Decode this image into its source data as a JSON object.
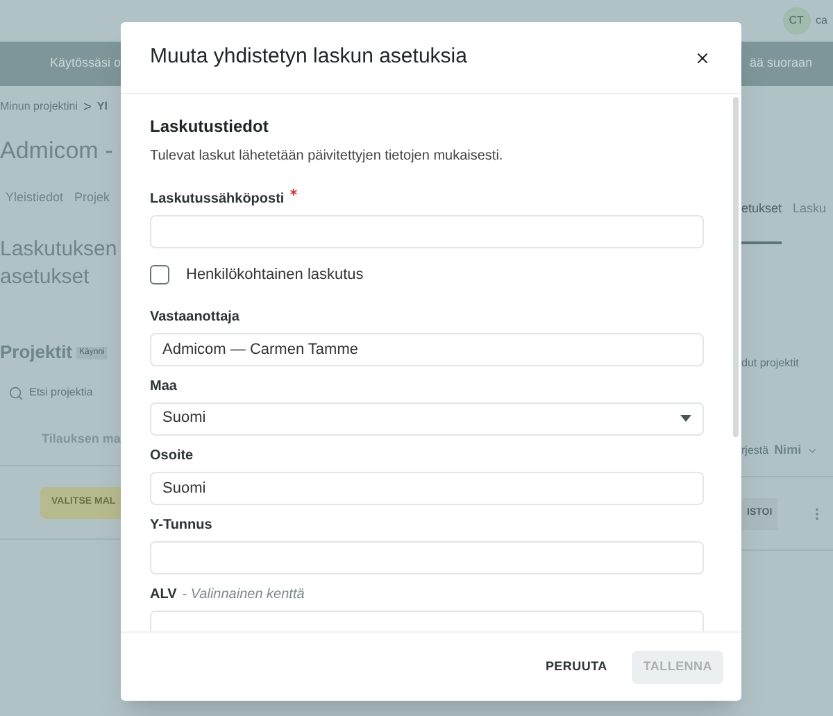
{
  "background": {
    "top_bar": {
      "avatar": "CT",
      "user": "ca"
    },
    "banner": {
      "left": "Käytössäsi o",
      "right": "ää suoraan"
    },
    "breadcrumb": {
      "items": [
        "Minun projektini",
        "Yl"
      ],
      "separator": ">"
    },
    "title": "Admicom -",
    "tabs_left": [
      {
        "label": "Yleistiedot",
        "selected": false
      },
      {
        "label": "Projek",
        "selected": false
      }
    ],
    "tabs_right": [
      {
        "label": "etukset",
        "selected": true
      },
      {
        "label": "Lasku",
        "selected": false
      }
    ],
    "section_title": "Laskutuksen asetukset",
    "projects": {
      "title": "Projektit",
      "badge": "Käynni",
      "filter": "dut projektit",
      "search_placeholder": "Etsi projektia",
      "column": "Tilauksen ma",
      "sort_label": "rjestä",
      "sort_value": "Nimi",
      "primary_button": "VALITSE MAL",
      "secondary_button": "ISTOI"
    }
  },
  "modal": {
    "title": "Muuta yhdistetyn laskun asetuksia",
    "section_title": "Laskutustiedot",
    "section_text": "Tulevat laskut lähetetään päivitettyjen tietojen mukaisesti.",
    "fields": [
      {
        "kind": "text",
        "label": "Laskutussähköposti",
        "required": true
      },
      {
        "kind": "checkbox",
        "label": "Henkilökohtainen laskutus",
        "checked": false
      },
      {
        "kind": "text",
        "label": "Vastaanottaja",
        "required": false,
        "value": "Admicom — Carmen Tamme"
      },
      {
        "kind": "select",
        "label": "Maa",
        "required": false,
        "value": "Suomi"
      },
      {
        "kind": "text",
        "label": "Osoite",
        "required": false,
        "value": "Suomi"
      },
      {
        "kind": "text",
        "label": "Y-Tunnus",
        "required": false
      },
      {
        "kind": "text",
        "label": "ALV",
        "required": false,
        "optional_note": "- Valinnainen kenttä"
      }
    ],
    "buttons": [
      {
        "label": "PERUUTA",
        "disabled": false
      },
      {
        "label": "TALLENNA",
        "disabled": true
      }
    ]
  }
}
